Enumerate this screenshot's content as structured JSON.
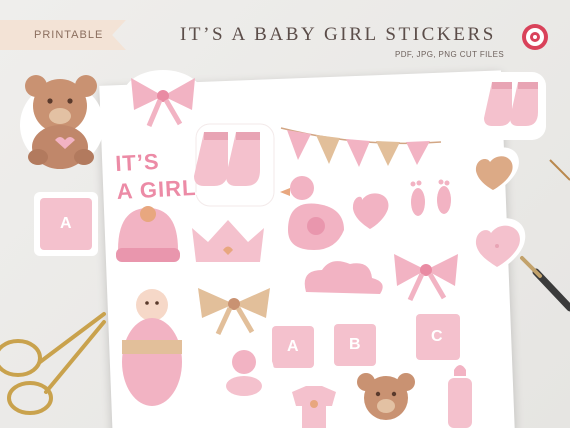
{
  "banner": {
    "tag": "PRINTABLE"
  },
  "header": {
    "title": "IT’S A BABY GIRL STICKERS",
    "subtitle": "PDF, JPG, PNG CUT FILES"
  },
  "stickers": {
    "text_line1": "IT’S",
    "text_line2": "A GIRL",
    "block_a1": "A",
    "block_a2": "A",
    "block_b": "B",
    "block_c": "C"
  },
  "colors": {
    "background": "#e9e8e5",
    "tag_fill": "#f3e3d6",
    "title_text": "#5b4d49",
    "sticker_pink": "#f2b3c3",
    "sticker_peach": "#e0b48f",
    "logo_red": "#d9425a"
  },
  "icons": [
    "teddy-bear-icon",
    "bow-icon",
    "socks-icon",
    "bunting-icon",
    "heart-icon",
    "block-icon",
    "baby-hat-icon",
    "crown-icon",
    "duck-icon",
    "footprints-icon",
    "cloud-icon",
    "swaddled-baby-icon",
    "onesie-icon",
    "pacifier-icon",
    "bottle-icon",
    "scissors-icon",
    "brush-pen-icon"
  ]
}
